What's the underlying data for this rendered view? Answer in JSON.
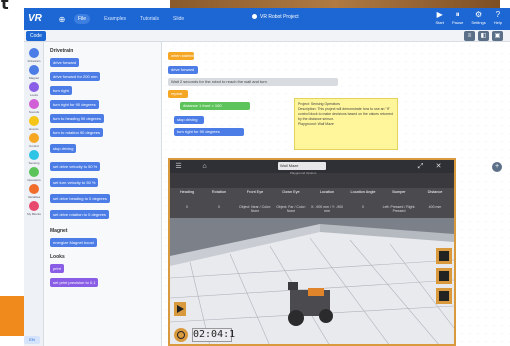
{
  "page": {
    "corner_glyph": "t"
  },
  "titlebar": {
    "logo": "VR",
    "menus": [
      "Examples",
      "Tutorials",
      "Slide"
    ],
    "project_title": "VR Robot Project",
    "controls": [
      {
        "glyph": "▶",
        "label": "Start"
      },
      {
        "glyph": "⏸",
        "label": "Pause"
      },
      {
        "glyph": "⚙",
        "label": "Settings"
      },
      {
        "glyph": "?",
        "label": "Help"
      }
    ],
    "color": "#1c67d3"
  },
  "tabs": {
    "code_label": "Code"
  },
  "categories": [
    {
      "label": "Drivetrain",
      "color": "#4c7de6"
    },
    {
      "label": "Magnet",
      "color": "#4c7de6"
    },
    {
      "label": "Looks",
      "color": "#8a5de6"
    },
    {
      "label": "Sounds",
      "color": "#d15fd6"
    },
    {
      "label": "Events",
      "color": "#f5c517"
    },
    {
      "label": "Control",
      "color": "#f5a623"
    },
    {
      "label": "Sensing",
      "color": "#2ec4e6"
    },
    {
      "label": "Operators",
      "color": "#5dc45b"
    },
    {
      "label": "Variables",
      "color": "#f06d2c"
    },
    {
      "label": "My Blocks",
      "color": "#e84a6d"
    }
  ],
  "palette": {
    "heading_drivetrain": "Drivetrain",
    "heading_magnet": "Magnet",
    "heading_looks": "Looks",
    "drivetrain_blocks": [
      "drive forward",
      "drive forward for 200 mm",
      "turn right",
      "turn right for 90 degrees",
      "turn to heading 90 degrees",
      "turn to rotation 90 degrees",
      "stop driving",
      "set drive velocity to 50 %",
      "set turn velocity to 50 %",
      "set drive heading to 0 degrees",
      "set drive rotation to 0 degrees"
    ],
    "magnet_blocks": [
      "energize Magnet boost"
    ],
    "looks_blocks": [
      "print",
      "set print precision to 0.1"
    ]
  },
  "workspace": {
    "blocks": [
      {
        "text": "when started",
        "color": "orange"
      },
      {
        "text": "drive forward",
        "color": "blue"
      },
      {
        "text": "Wait 2 seconds for the robot to reach the wall and turn",
        "color": "gray"
      },
      {
        "text": "repeat",
        "color": "orange"
      },
      {
        "text": "distance 1  front  < 100",
        "color": "green"
      },
      {
        "text": "stop driving",
        "color": "blue"
      },
      {
        "text": "turn right  for  90 degrees",
        "color": "blue"
      }
    ],
    "note": {
      "title": "Project: Sensing Operators",
      "body": "Description: This project will demonstrate how to use an \"If\" control block to make decisions based on the values returned by the distance sensor.",
      "footer": "Playground: Wall Maze"
    }
  },
  "sim": {
    "playground_select": "Wall Maze",
    "subtitle": "Playground Options",
    "columns": [
      "Heading",
      "Rotation",
      "Front Eye",
      "Down Eye",
      "Location",
      "Location Angle",
      "Bumper",
      "Distance"
    ],
    "row": [
      "0",
      "0",
      "Object: Near / Color: None",
      "Object: Far / Color: None",
      "X: -900 mm / Y: -900 mm",
      "0",
      "Left: Pressed / Right: Pressed",
      "400 mm"
    ],
    "timer": "02:04:1"
  },
  "footer": {
    "badge": "EN"
  }
}
